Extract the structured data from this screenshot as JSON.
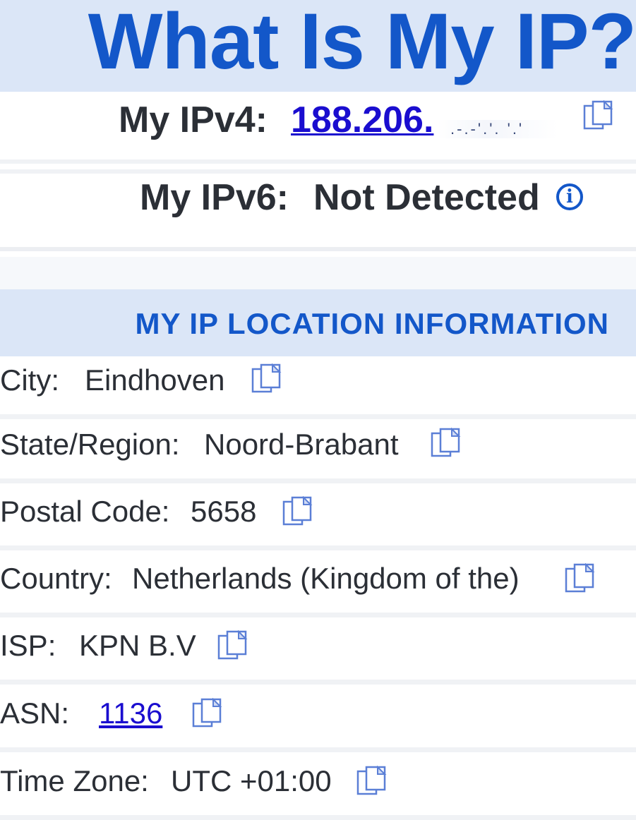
{
  "header": {
    "title": "What Is My IP?"
  },
  "ipv4": {
    "label": "My IPv4:",
    "value": "188.206.",
    "masked_suffix": ".-.-'.'.  '.'"
  },
  "ipv6": {
    "label": "My IPv6:",
    "value": "Not Detected",
    "info_icon_glyph": "i"
  },
  "location": {
    "heading": "MY IP LOCATION INFORMATION",
    "rows": [
      {
        "label": "City:",
        "value": "Eindhoven"
      },
      {
        "label": "State/Region:",
        "value": "Noord-Brabant"
      },
      {
        "label": "Postal Code:",
        "value": "5658"
      },
      {
        "label": "Country:",
        "value": "Netherlands (Kingdom of the)"
      },
      {
        "label": "ISP:",
        "value": "KPN B.V"
      },
      {
        "label": "ASN:",
        "value": "1136"
      },
      {
        "label": "Time Zone:",
        "value": "UTC +01:00"
      }
    ]
  },
  "icons": {
    "copy": "copy-icon",
    "info": "info-icon"
  },
  "colors": {
    "accent": "#1357c9",
    "banner_bg": "#dbe6f7",
    "link": "#1a0dcf",
    "text": "#2b2f36"
  }
}
